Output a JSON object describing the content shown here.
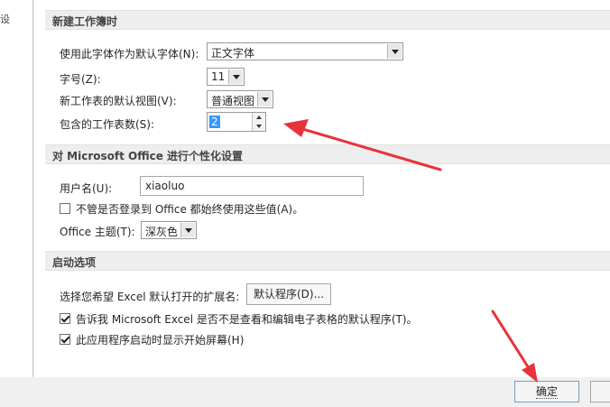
{
  "left_nav": {
    "partial_item": "设"
  },
  "sections": {
    "new_workbook": {
      "header": "新建工作簿时",
      "font_label": "使用此字体作为默认字体(N):",
      "font_value": "正文字体",
      "size_label": "字号(Z):",
      "size_value": "11",
      "view_label": "新工作表的默认视图(V):",
      "view_value": "普通视图",
      "sheets_label": "包含的工作表数(S):",
      "sheets_value": "2"
    },
    "personalize": {
      "header": "对 Microsoft Office 进行个性化设置",
      "username_label": "用户名(U):",
      "username_value": "xiaoluo",
      "always_use_label": "不管是否登录到 Office 都始终使用这些值(A)。",
      "always_use_checked": false,
      "theme_label": "Office 主题(T):",
      "theme_value": "深灰色"
    },
    "startup": {
      "header": "启动选项",
      "extensions_label": "选择您希望 Excel 默认打开的扩展名:",
      "default_programs_button": "默认程序(D)...",
      "tell_me_label": "告诉我 Microsoft Excel 是否不是查看和编辑电子表格的默认程序(T)。",
      "tell_me_checked": true,
      "show_start_label": "此应用程序启动时显示开始屏幕(H)",
      "show_start_checked": true
    }
  },
  "footer": {
    "ok_label": "确定"
  },
  "colors": {
    "annotation_arrow": "#e8333b",
    "selection": "#3399ff"
  }
}
